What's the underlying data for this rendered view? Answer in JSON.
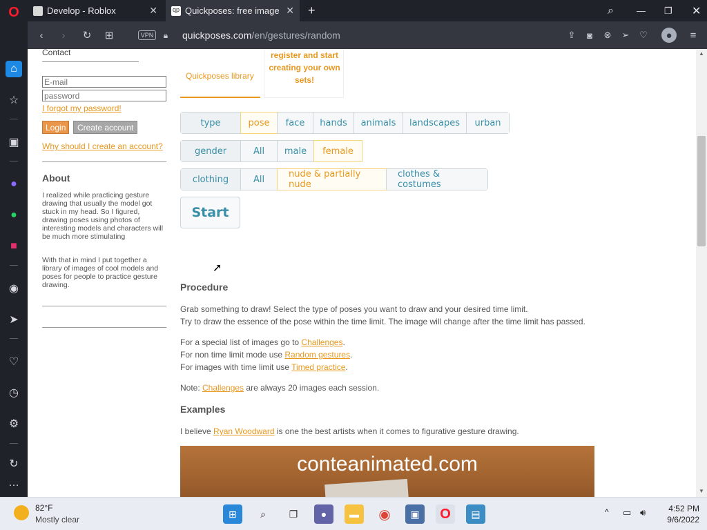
{
  "browser": {
    "tabs": [
      {
        "title": "Develop - Roblox"
      },
      {
        "title": "Quickposes: free image libr"
      }
    ],
    "url_domain": "quickposes.com",
    "url_path": "/en/gestures/random",
    "vpn_label": "VPN"
  },
  "left_panel": {
    "contact": "Contact",
    "email_placeholder": "E-mail",
    "password_placeholder": "password",
    "forgot": "I forgot my password!",
    "login": "Login",
    "create": "Create account",
    "why": "Why should I create an account?",
    "about_title": "About",
    "about_p1": "I realized while practicing gesture drawing that usually the model got stuck in my head. So I figured, drawing poses using photos of interesting models and characters will be much more stimulating",
    "about_p2": "With that in mind I put together a library of images of cool models and poses for people to practice gesture drawing."
  },
  "tabs_area": {
    "library": "Quickposes library",
    "register": "register and start creating your own sets!"
  },
  "filters": {
    "row1": [
      "type",
      "pose",
      "face",
      "hands",
      "animals",
      "landscapes",
      "urban"
    ],
    "row2": [
      "gender",
      "All",
      "male",
      "female"
    ],
    "row3": [
      "clothing",
      "All",
      "nude & partially nude",
      "clothes & costumes"
    ],
    "start": "Start"
  },
  "procedure": {
    "title": "Procedure",
    "line1": "Grab something to draw! Select the type of poses you want to draw and your desired time limit.",
    "line2": "Try to draw the essence of the pose within the time limit. The image will change after the time limit has passed.",
    "special_pre": "For a special list of images go to ",
    "special_link": "Challenges",
    "nontime_pre": "For non time limit mode use ",
    "nontime_link": "Random gestures",
    "timed_pre": "For images with time limit use ",
    "timed_link": "Timed practice",
    "note_pre": "Note: ",
    "note_link": "Challenges",
    "note_post": " are always 20 images each session.",
    "period": "."
  },
  "examples": {
    "title": "Examples",
    "pre": "I believe ",
    "link": "Ryan Woodward",
    "post": " is one the best artists when it comes to figurative gesture drawing.",
    "image_text": "conteanimated.com"
  },
  "taskbar": {
    "temp": "82°F",
    "weather": "Mostly clear",
    "time": "4:52 PM",
    "date": "9/6/2022"
  },
  "colors": {
    "accent_orange": "#e8981f",
    "button_blue": "#3a8fa8"
  }
}
